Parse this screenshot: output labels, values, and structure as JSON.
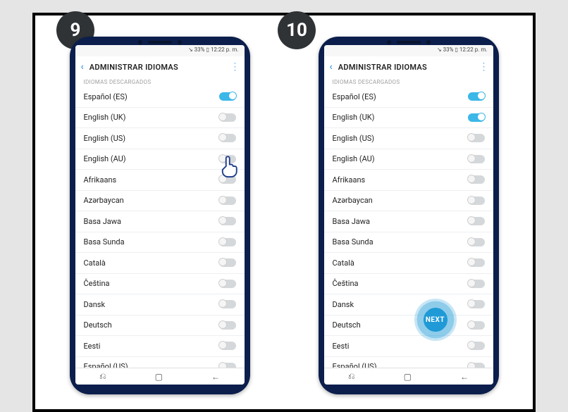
{
  "steps": {
    "left": "9",
    "right": "10"
  },
  "statusbar": "↘ 33% ▯ 12:22 p. m.",
  "appbar": {
    "title": "ADMINISTRAR IDIOMAS",
    "back_icon": "back",
    "more_icon": "more"
  },
  "section_label": "IDIOMAS DESCARGADOS",
  "navbar": {
    "recents": "⌧",
    "home": "▢",
    "back": "←"
  },
  "next_label": "NEXT",
  "languages": [
    {
      "name": "Español (ES)"
    },
    {
      "name": "English (UK)"
    },
    {
      "name": "English (US)"
    },
    {
      "name": "English (AU)"
    },
    {
      "name": "Afrikaans"
    },
    {
      "name": "Azərbaycan"
    },
    {
      "name": "Basa Jawa"
    },
    {
      "name": "Basa Sunda"
    },
    {
      "name": "Català"
    },
    {
      "name": "Čeština"
    },
    {
      "name": "Dansk"
    },
    {
      "name": "Deutsch"
    },
    {
      "name": "Eesti"
    },
    {
      "name": "Español (US)"
    }
  ],
  "toggles_step9": [
    true,
    false,
    false,
    false,
    false,
    false,
    false,
    false,
    false,
    false,
    false,
    false,
    false,
    false
  ],
  "toggles_step10": [
    true,
    true,
    false,
    false,
    false,
    false,
    false,
    false,
    false,
    false,
    false,
    false,
    false,
    false
  ]
}
